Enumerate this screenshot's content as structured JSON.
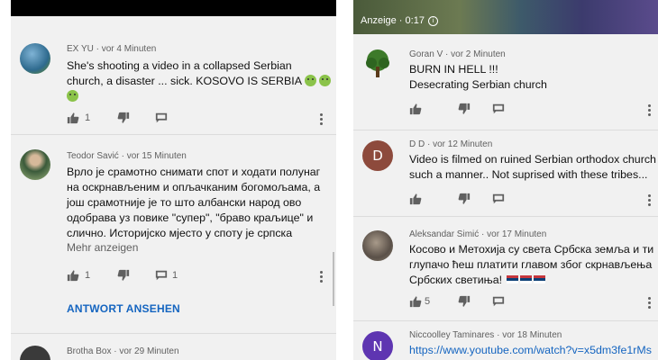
{
  "left": {
    "comments": [
      {
        "author": "EX YU",
        "time": "vor 4 Minuten",
        "lines": [
          "She's shooting a video in a collapsed Serbian",
          "church, a disaster ... sick.  KOSOVO IS SERBIA"
        ],
        "likes": "1"
      },
      {
        "author": "Teodor Savić",
        "time": "vor 15 Minuten",
        "lines": [
          "Врло је срамотно снимати спот и ходати полунаг",
          "на оскрнављеним и опљачканим богомољама, а",
          "још срамотније је то што албански народ ово",
          "одобрава уз повике \"супер\", \"браво краљице\" и",
          "слично. Историјско мјесто у споту је српска"
        ],
        "more": "Mehr anzeigen",
        "likes": "1",
        "replies": "1",
        "reply_link": "ANTWORT ANSEHEN"
      },
      {
        "author": "Brotha Box",
        "time": "vor 29 Minuten"
      }
    ]
  },
  "right": {
    "ad_label": "Anzeige · 0:17",
    "comments": [
      {
        "author": "Goran V",
        "time": "vor 2 Minuten",
        "lines": [
          "BURN IN HELL !!!",
          "Desecrating Serbian church"
        ]
      },
      {
        "author": "D D",
        "time": "vor 12 Minuten",
        "avatar_letter": "D",
        "avatar_color": "#8d4a3c",
        "lines": [
          "Video is filmed on ruined Serbian orthodox church in",
          "such a manner..  Not suprised with these tribes..."
        ]
      },
      {
        "author": "Aleksandar Simić",
        "time": "vor 17 Minuten",
        "lines": [
          "Косово и Метохија су света Србска земља и ти",
          "глупачо ћеш платити главом због скрнављења",
          "Србских светиња!"
        ],
        "likes": "5"
      },
      {
        "author": "Niccoolley Taminares",
        "time": "vor 18 Minuten",
        "avatar_letter": "N",
        "avatar_color": "#5e35b1",
        "link": "https://www.youtube.com/watch?v=x5dm3fe1rMs"
      }
    ]
  },
  "colors": {
    "link": "#1565c0",
    "meta": "#606060",
    "panel_bg": "#f1f1f1"
  }
}
